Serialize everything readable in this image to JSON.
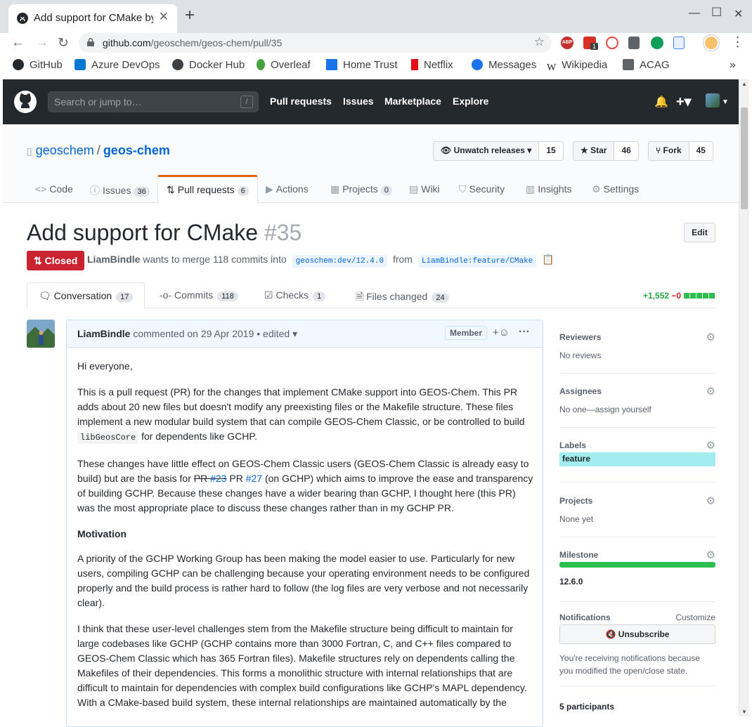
{
  "browser": {
    "tab_title": "Add support for CMake by LiamBindle",
    "url_domain": "github.com",
    "url_path": "/geoschem/geos-chem/pull/35",
    "bookmarks": [
      "GitHub",
      "Azure DevOps",
      "Docker Hub",
      "Overleaf",
      "Home Trust",
      "Netflix",
      "Messages",
      "Wikipedia",
      "ACAG"
    ],
    "bookmark_colors": [
      "#24292e",
      "#0078d4",
      "#3c4043",
      "#47a141",
      "#1a73e8",
      "#e50914",
      "#1a73e8",
      "#202124",
      "#5f6368"
    ],
    "ext_badge": "1"
  },
  "gh_header": {
    "search_placeholder": "Search or jump to…",
    "slash": "/",
    "nav": [
      "Pull requests",
      "Issues",
      "Marketplace",
      "Explore"
    ]
  },
  "repo": {
    "owner": "geoschem",
    "separator": "/",
    "name": "geos-chem",
    "watch_label": "Unwatch releases",
    "watch_count": "15",
    "star_label": "Star",
    "star_count": "46",
    "fork_label": "Fork",
    "fork_count": "45",
    "tabs": {
      "code": "Code",
      "issues": "Issues",
      "issues_count": "36",
      "pulls": "Pull requests",
      "pulls_count": "6",
      "actions": "Actions",
      "projects": "Projects",
      "projects_count": "0",
      "wiki": "Wiki",
      "security": "Security",
      "insights": "Insights",
      "settings": "Settings"
    }
  },
  "pr": {
    "title": "Add support for CMake",
    "number": "#35",
    "edit": "Edit",
    "state": "Closed",
    "author": "LiamBindle",
    "merge_text": "wants to merge 118 commits into",
    "base": "geoschem:dev/12.4.0",
    "from": "from",
    "head": "LiamBindle:feature/CMake",
    "tabs": {
      "conversation": "Conversation",
      "conversation_count": "17",
      "commits": "Commits",
      "commits_count": "118",
      "checks": "Checks",
      "checks_count": "1",
      "files": "Files changed",
      "files_count": "24"
    },
    "additions": "+1,552",
    "deletions": "−0"
  },
  "comment": {
    "author": "LiamBindle",
    "meta": "commented on 29 Apr 2019 • edited",
    "role": "Member",
    "p1": "Hi everyone,",
    "p2a": "This is a pull request (PR) for the changes that implement CMake support into GEOS-Chem. This PR adds about 20 new files but doesn't modify any preexisting files or the Makefile structure. These files implement a new modular build system that can compile GEOS-Chem Classic, or be controlled to build ",
    "p2code": "libGeosCore",
    "p2b": " for dependents like GCHP.",
    "p3a": "These changes have little effect on GEOS-Chem Classic users (GEOS-Chem Classic is already easy to build) but are the basis for ",
    "p3s1": "PR",
    "p3s2": "#23",
    "p3b": " PR ",
    "p3link": "#27",
    "p3c": " (on GCHP) which aims to improve the ease and transparency of building GCHP. Because these changes have a wider bearing than GCHP, I thought here (this PR) was the most appropriate place to discuss these changes rather than in my GCHP PR.",
    "h_motivation": "Motivation",
    "p4": "A priority of the GCHP Working Group has been making the model easier to use. Particularly for new users, compiling GCHP can be challenging because your operating environment needs to be configured properly and the build process is rather hard to follow (the log files are very verbose and not necessarily clear).",
    "p5": "I think that these user-level challenges stem from the Makefile structure being difficult to maintain for large codebases like GCHP (GCHP contains more than 3000 Fortran, C, and C++ files compared to GEOS-Chem Classic which has 365 Fortran files). Makefile structures rely on dependents calling the Makefiles of their dependencies. This forms a monolithic structure with internal relationships that are difficult to maintain for dependencies with complex build configurations like GCHP's MAPL dependency. With a CMake-based build system, these internal relationships are maintained automatically by the"
  },
  "sidebar": {
    "reviewers": "Reviewers",
    "reviewers_val": "No reviews",
    "assignees": "Assignees",
    "assignees_val": "No one—assign yourself",
    "labels": "Labels",
    "label_feature": "feature",
    "projects": "Projects",
    "projects_val": "None yet",
    "milestone": "Milestone",
    "milestone_val": "12.6.0",
    "milestone_progress": 1.0,
    "notifications": "Notifications",
    "customize": "Customize",
    "unsubscribe": "Unsubscribe",
    "notif_text1": "You're receiving notifications because",
    "notif_text2": "you modified the open/close state.",
    "participants": "5 participants"
  },
  "colors": {
    "closed": "#cb2431",
    "link": "#0366d6",
    "label_feature": "#a2eeef",
    "add": "#28a745",
    "tab_accent": "#e36209"
  }
}
